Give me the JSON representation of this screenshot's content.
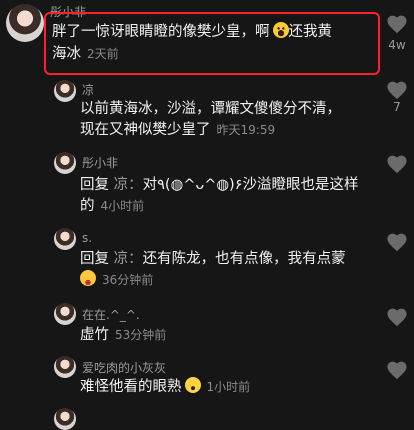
{
  "comments": [
    {
      "name": "彤小非",
      "lines": [
        "胖了一惊讶眼睛瞪的像樊少皇，啊",
        "海冰"
      ],
      "line1_suffix": "还我黄",
      "emoji": "astonished-emoji",
      "time": "2天前",
      "like_count": "4w",
      "highlight_color": "#ff1f2d"
    },
    {
      "name": "凉",
      "lines": [
        "以前黄海冰，沙溢，谭耀文傻傻分不清，",
        "现在又神似樊少皇了"
      ],
      "time": "昨天19:59",
      "like_count": "7"
    },
    {
      "name": "彤小非",
      "prefix": "回复",
      "target": "凉：",
      "lines": [
        "对٩(◍^ᴗ^◍)۶沙溢瞪眼也是这样",
        "的"
      ],
      "time": "4小时前",
      "like_count": ""
    },
    {
      "name": "s.",
      "prefix": "回复",
      "target": "凉：",
      "lines": [
        "还有陈龙，也有点像，我有点蒙"
      ],
      "emoji": "laughing-emoji",
      "time": "36分钟前",
      "like_count": ""
    },
    {
      "name": "在在.^_^.",
      "lines": [
        "虚竹"
      ],
      "time": "53分钟前",
      "like_count": ""
    },
    {
      "name": "爱吃肉的小灰灰",
      "lines": [
        "难怪他看的眼熟"
      ],
      "emoji": "grin-emoji",
      "time": "1小时前",
      "like_count": ""
    }
  ]
}
